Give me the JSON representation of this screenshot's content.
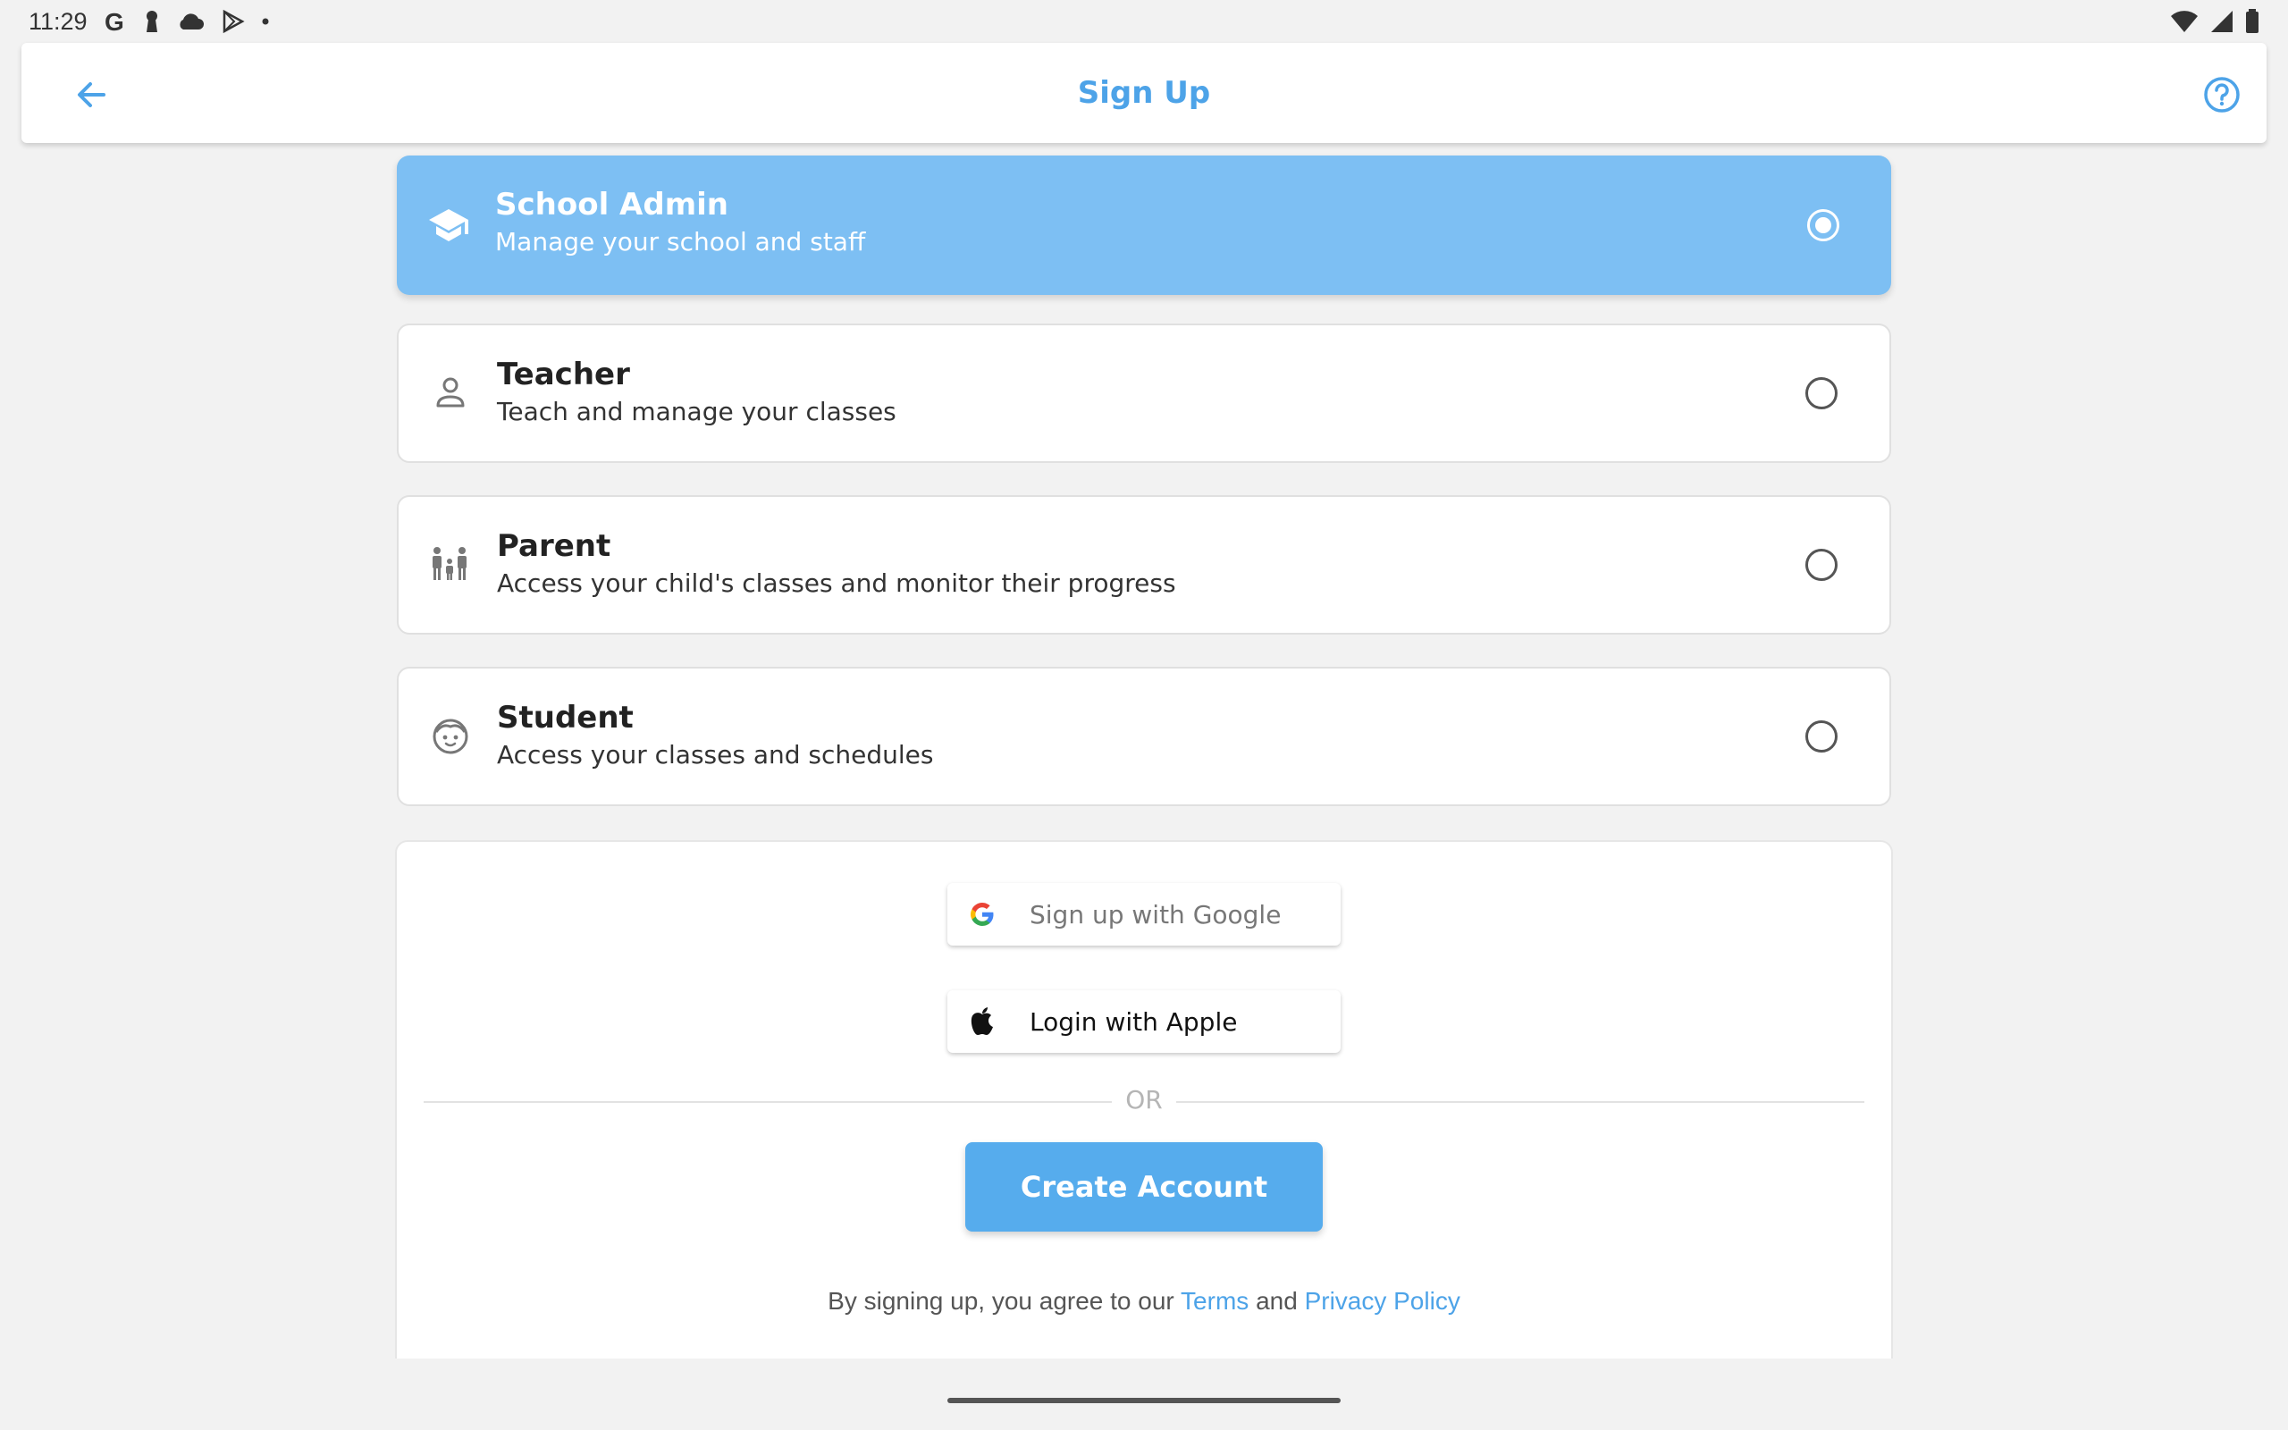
{
  "status_bar": {
    "time": "11:29",
    "left_icons": [
      "google-icon",
      "keyhole-icon",
      "cloud-icon",
      "play-store-icon",
      "dot-icon"
    ],
    "right_icons": [
      "wifi-icon",
      "cellular-signal-icon",
      "battery-icon"
    ]
  },
  "app_bar": {
    "title": "Sign Up",
    "back_icon": "arrow-back-icon",
    "help_icon": "help-circle-icon",
    "accent_color": "#4da3e8"
  },
  "roles": [
    {
      "title": "School Admin",
      "description": "Manage your school and staff",
      "icon": "graduation-cap-icon",
      "selected": true
    },
    {
      "title": "Teacher",
      "description": "Teach and manage your classes",
      "icon": "person-icon",
      "selected": false
    },
    {
      "title": "Parent",
      "description": "Access your child's classes and monitor their progress",
      "icon": "family-icon",
      "selected": false
    },
    {
      "title": "Student",
      "description": "Access your classes and schedules",
      "icon": "child-face-icon",
      "selected": false
    }
  ],
  "auth": {
    "google_label": "Sign up with Google",
    "apple_label": "Login with Apple",
    "or_label": "OR",
    "create_label": "Create Account",
    "legal_prefix": "By signing up, you agree to our",
    "terms_label": "Terms",
    "legal_and": "and",
    "privacy_label": "Privacy Policy"
  },
  "colors": {
    "selected_card": "#7dbff3",
    "primary_button": "#56aced",
    "link": "#4da3e8",
    "background": "#f2f2f2"
  }
}
